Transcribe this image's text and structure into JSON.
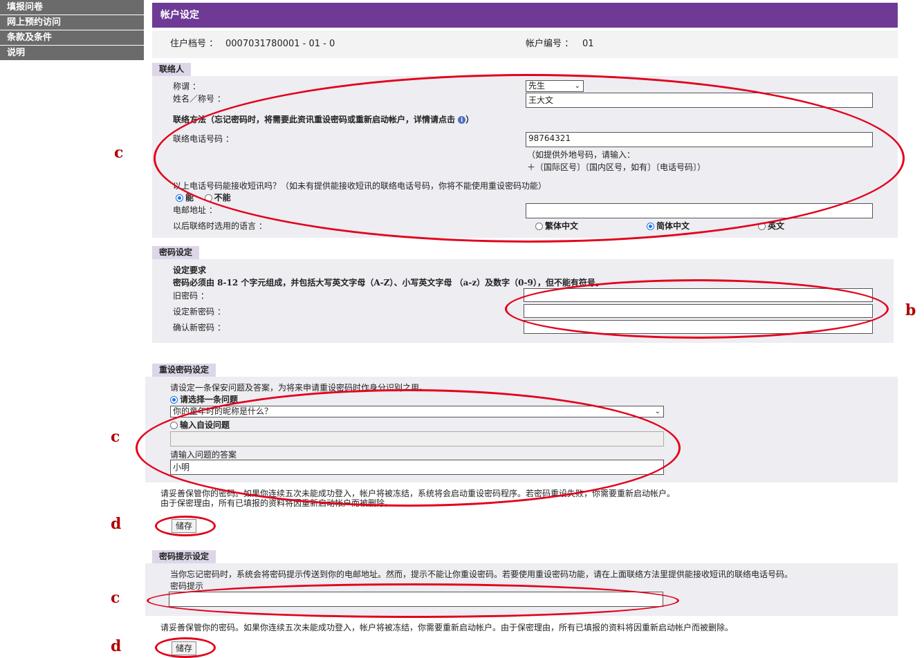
{
  "sidebar": {
    "items": [
      {
        "label": "填报问卷"
      },
      {
        "label": "网上预约访问"
      },
      {
        "label": "条款及条件"
      },
      {
        "label": "说明"
      }
    ]
  },
  "header": {
    "title": "帐户设定"
  },
  "account": {
    "household_label": "住户档号 ：",
    "household_value": "0007031780001 - 01 - 0",
    "account_label": "帐户编号 ：",
    "account_value": "01"
  },
  "contact": {
    "title": "联络人",
    "salutation_label": "称谓 ：",
    "salutation_value": "先生",
    "name_label": "姓名／称号 ：",
    "name_value": "王大文",
    "method_heading": "联络方法（忘记密码时，将需要此资讯重设密码或重新启动帐户，详情请点击",
    "method_heading_end": "）",
    "phone_label": "联络电话号码 ：",
    "phone_value": "98764321",
    "phone_hint_1": "（如提供外地号码，请输入：",
    "phone_hint_2": "＋〔国际区号〕〔国内区号，如有〕〔电话号码〕）",
    "sms_question": "以上电话号码能接收短讯吗？（如未有提供能接收短讯的联络电话号码，你将不能使用重设密码功能）",
    "sms_yes": "能",
    "sms_no": "不能",
    "email_label": "电邮地址 ：",
    "email_value": "",
    "language_label": "以后联络时选用的语言 ：",
    "lang_trad": "繁体中文",
    "lang_simp": "简体中文",
    "lang_en": "英文"
  },
  "password": {
    "title": "密码设定",
    "req_title": "设定要求",
    "req_text": "密码必须由 8-12 个字元组成，并包括大写英文字母（A-Z）、小写英文字母 （a-z）及数字（0-9），但不能有符号。",
    "old_label": "旧密码 ：",
    "new_label": "设定新密码 ：",
    "confirm_label": "确认新密码 ："
  },
  "reset": {
    "title": "重设密码设定",
    "intro": "请设定一条保安问题及答案，为将来申请重设密码时作身分识别之用。",
    "choose_label": "请选择一条问题",
    "question_value": "你的童年时的昵称是什么？",
    "custom_label": "输入自设问题",
    "custom_value": "",
    "answer_label": "请输入问题的答案",
    "answer_value": "小明",
    "note1": "请妥善保管你的密码。如果你连续五次未能成功登入，帐户将被冻结，系统将会启动重设密码程序。若密码重设失败，你需要重新启动帐户。",
    "note2": "由于保密理由，所有已填报的资料将因重新启动帐户而被删除。",
    "save_label": "储存"
  },
  "hint": {
    "title": "密码提示设定",
    "intro": "当你忘记密码时，系统会将密码提示传送到你的电邮地址。然而，提示不能让你重设密码。若要使用重设密码功能，请在上面联络方法里提供能接收短讯的联络电话号码。",
    "label": "密码提示",
    "value": "",
    "note": "请妥善保管你的密码。如果你连续五次未能成功登入，帐户将被冻结，你需要重新启动帐户。由于保密理由，所有已填报的资料将因重新启动帐户而被删除。",
    "save_label": "储存"
  },
  "annotations": {
    "c": "c",
    "b": "b",
    "d": "d"
  },
  "colors": {
    "header": "#6e3a96",
    "sidebar": "#6b6b6b",
    "annotation": "#e3001b",
    "section_tab": "#ddd6e8"
  }
}
